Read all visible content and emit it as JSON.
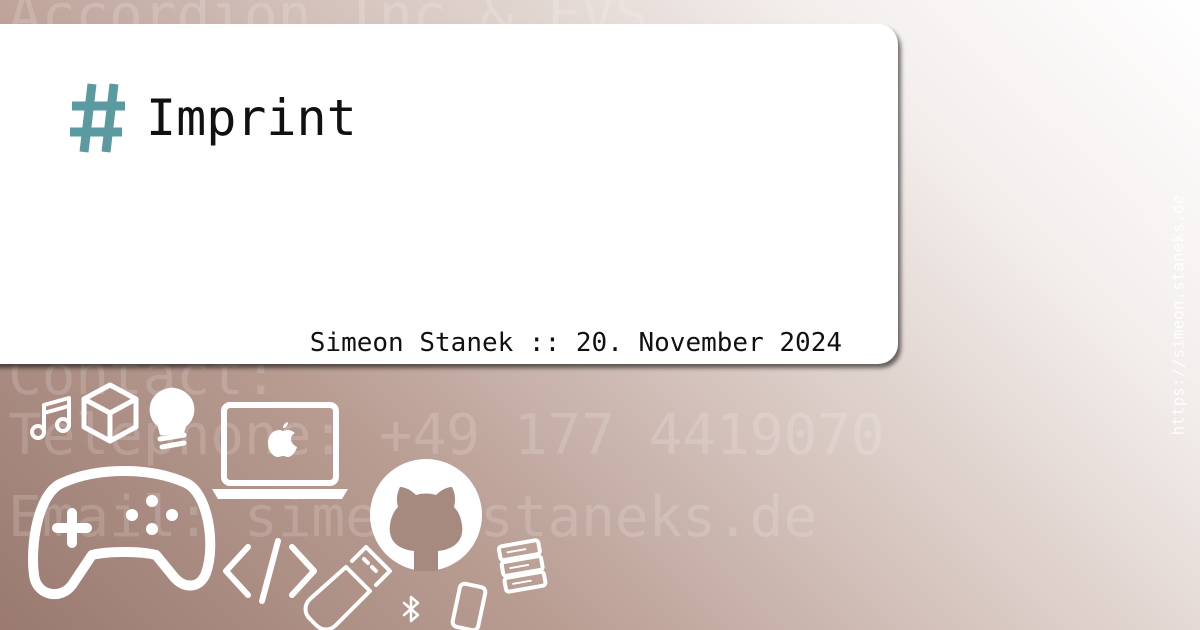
{
  "background_text": {
    "line1": "Accordion Inc & EVS",
    "line2": "Contact:",
    "line3": "Telephone: +49 177 4419070",
    "line4": "Email: simeon@staneks.de"
  },
  "card": {
    "title": "Imprint",
    "hash_symbol": "#",
    "footer": "Simeon Stanek :: 20. November 2024"
  },
  "side_url": "https://simeon.staneks.de",
  "colors": {
    "accent": "#5b9aa0",
    "text": "#111111",
    "card": "#ffffff"
  },
  "icons": [
    "music-note-icon",
    "cube-icon",
    "lightbulb-icon",
    "apple-laptop-icon",
    "gamepad-icon",
    "code-icon",
    "github-icon",
    "usb-stick-icon",
    "bluetooth-icon",
    "smartphone-icon",
    "server-icon"
  ]
}
